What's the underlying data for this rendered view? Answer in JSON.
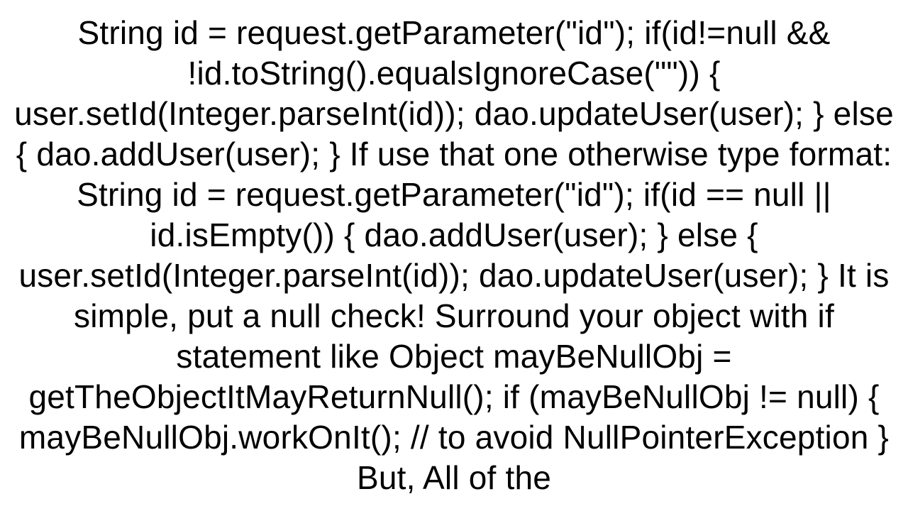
{
  "text": "String id = request.getParameter(\"id\");         if(id!=null && !id.toString().equalsIgnoreCase(\"\"))         {             user.setId(Integer.parseInt(id));             dao.updateUser(user);         }         else         {             dao.addUser(user);         }  If use that one otherwise type format: String id = request.getParameter(\"id\");          if(id == null || id.isEmpty())         {             dao.addUser(user);         }         else         {             user.setId(Integer.parseInt(id));             dao.updateUser(user);         }  It is simple, put a null check! Surround your object with if statement like Object mayBeNullObj = getTheObjectItMayReturnNull();  if (mayBeNullObj != null)     {       mayBeNullObj.workOnIt();     // to avoid NullPointerException   }  But, All of the"
}
